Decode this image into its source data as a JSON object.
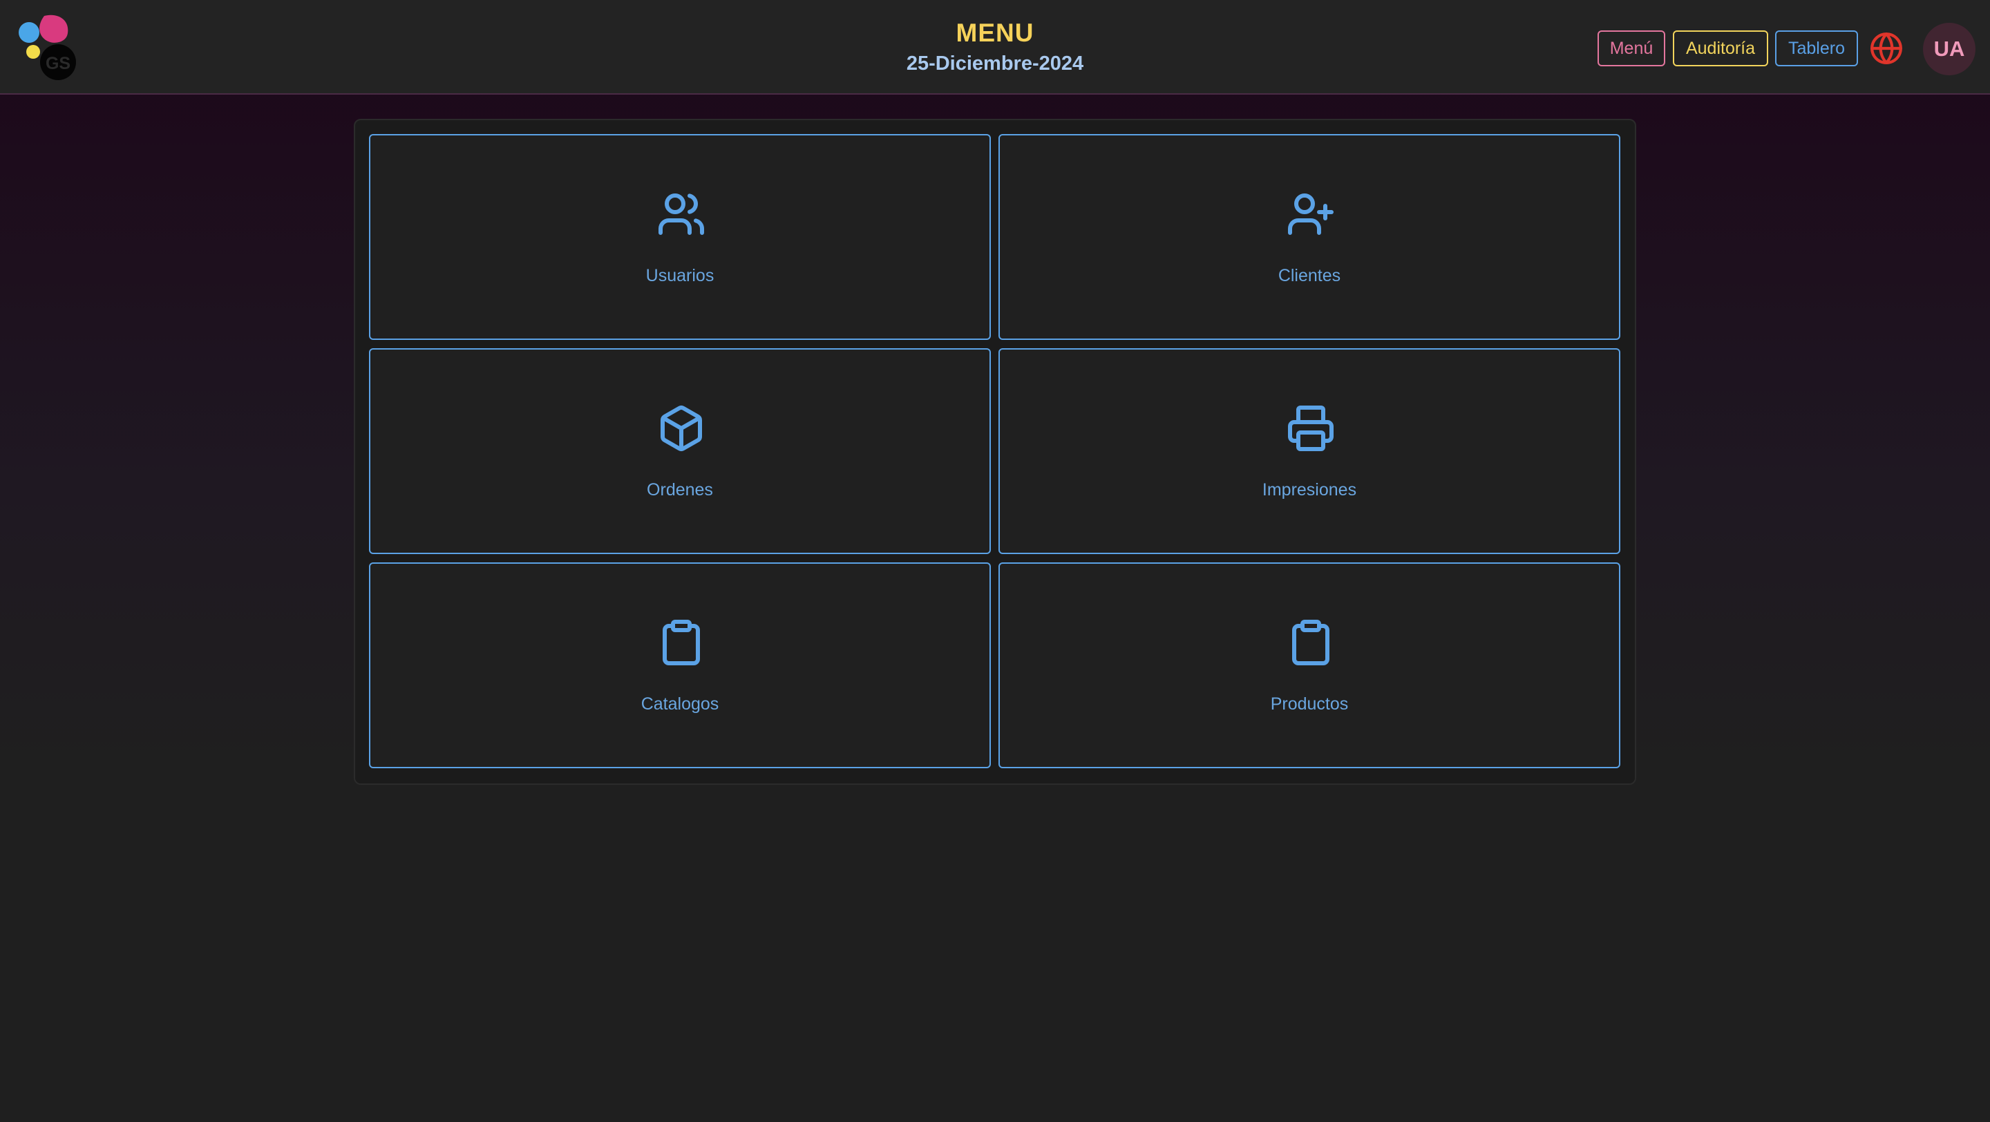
{
  "header": {
    "logo_text": "GS",
    "title": "MENU",
    "date": "25-Diciembre-2024",
    "nav": {
      "menu_label": "Menú",
      "audit_label": "Auditoría",
      "board_label": "Tablero"
    },
    "language_icon": "globe-icon",
    "avatar_initials": "UA"
  },
  "colors": {
    "accent_blue": "#5ba2e6",
    "accent_yellow": "#f6d25a",
    "accent_pink": "#e4769e",
    "globe_red": "#e0352b"
  },
  "cards": [
    {
      "label": "Usuarios",
      "icon": "users-icon"
    },
    {
      "label": "Clientes",
      "icon": "user-plus-icon"
    },
    {
      "label": "Ordenes",
      "icon": "package-icon"
    },
    {
      "label": "Impresiones",
      "icon": "printer-icon"
    },
    {
      "label": "Catalogos",
      "icon": "clipboard-icon"
    },
    {
      "label": "Productos",
      "icon": "clipboard-icon"
    }
  ]
}
